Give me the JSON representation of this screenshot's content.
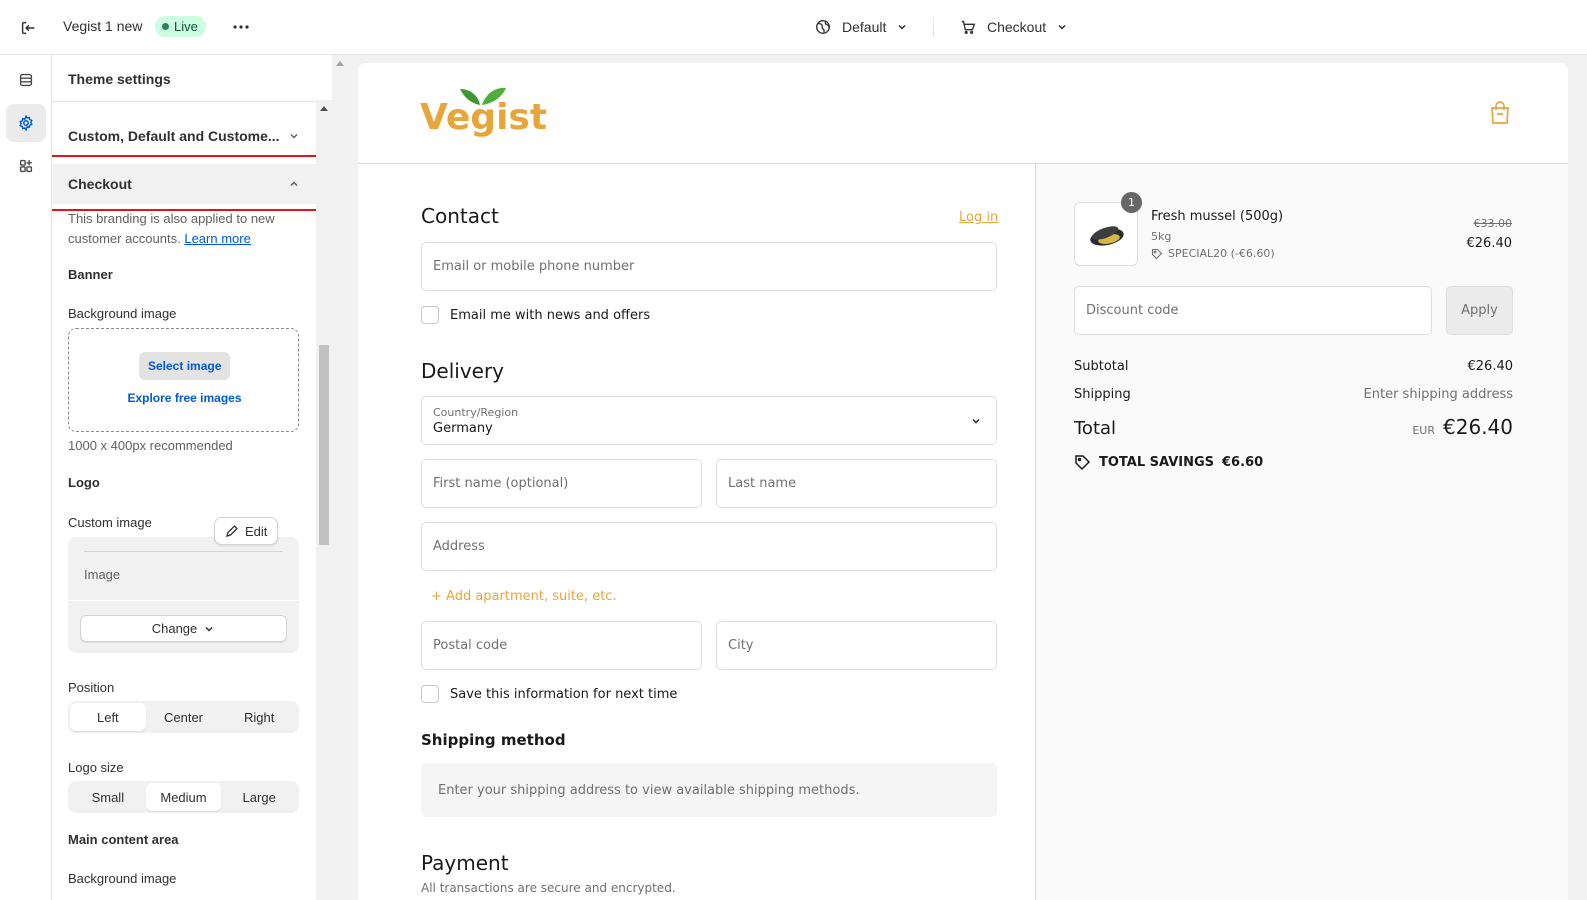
{
  "topbar": {
    "title": "Vegist 1 new",
    "badge": "Live",
    "theme_selector": "Default",
    "page_selector": "Checkout"
  },
  "sidebar": {
    "header": "Theme settings",
    "accordion_collapsed": "Custom, Default and Custome...",
    "accordion_open": "Checkout",
    "intro_text": "This branding is also applied to new customer accounts.",
    "learn_more": "Learn more",
    "banner_heading": "Banner",
    "bg_image_label": "Background image",
    "select_image": "Select image",
    "explore_images": "Explore free images",
    "recommended": "1000 x 400px recommended",
    "logo_heading": "Logo",
    "custom_image_label": "Custom image",
    "edit_label": "Edit",
    "image_label": "Image",
    "change_label": "Change",
    "position_label": "Position",
    "position_options": [
      "Left",
      "Center",
      "Right"
    ],
    "position_selected": "Left",
    "logo_size_label": "Logo size",
    "logo_size_options": [
      "Small",
      "Medium",
      "Large"
    ],
    "logo_size_selected": "Medium",
    "main_content_heading": "Main content area",
    "main_bg_label": "Background image"
  },
  "preview": {
    "brand": "Vegist",
    "brand_color": "#e8a53a",
    "leaf_color": "#3a9a2e",
    "contact_heading": "Contact",
    "login_link": "Log in",
    "email_placeholder": "Email or mobile phone number",
    "news_checkbox": "Email me with news and offers",
    "delivery_heading": "Delivery",
    "country_label": "Country/Region",
    "country_value": "Germany",
    "first_name": "First name (optional)",
    "last_name": "Last name",
    "address": "Address",
    "add_apartment": "+ Add apartment, suite, etc.",
    "postal_code": "Postal code",
    "city": "City",
    "save_info": "Save this information for next time",
    "shipping_heading": "Shipping method",
    "shipping_note": "Enter your shipping address to view available shipping methods.",
    "payment_heading": "Payment",
    "payment_note": "All transactions are secure and encrypted."
  },
  "summary": {
    "product_qty": "1",
    "product_name": "Fresh mussel (500g)",
    "product_variant": "5kg",
    "product_discount": "SPECIAL20 (-€6.60)",
    "price_old": "€33.00",
    "price_new": "€26.40",
    "discount_placeholder": "Discount code",
    "apply": "Apply",
    "subtotal_label": "Subtotal",
    "subtotal_value": "€26.40",
    "shipping_label": "Shipping",
    "shipping_value": "Enter shipping address",
    "total_label": "Total",
    "total_currency": "EUR",
    "total_value": "€26.40",
    "savings_label": "TOTAL SAVINGS",
    "savings_value": "€6.60"
  }
}
